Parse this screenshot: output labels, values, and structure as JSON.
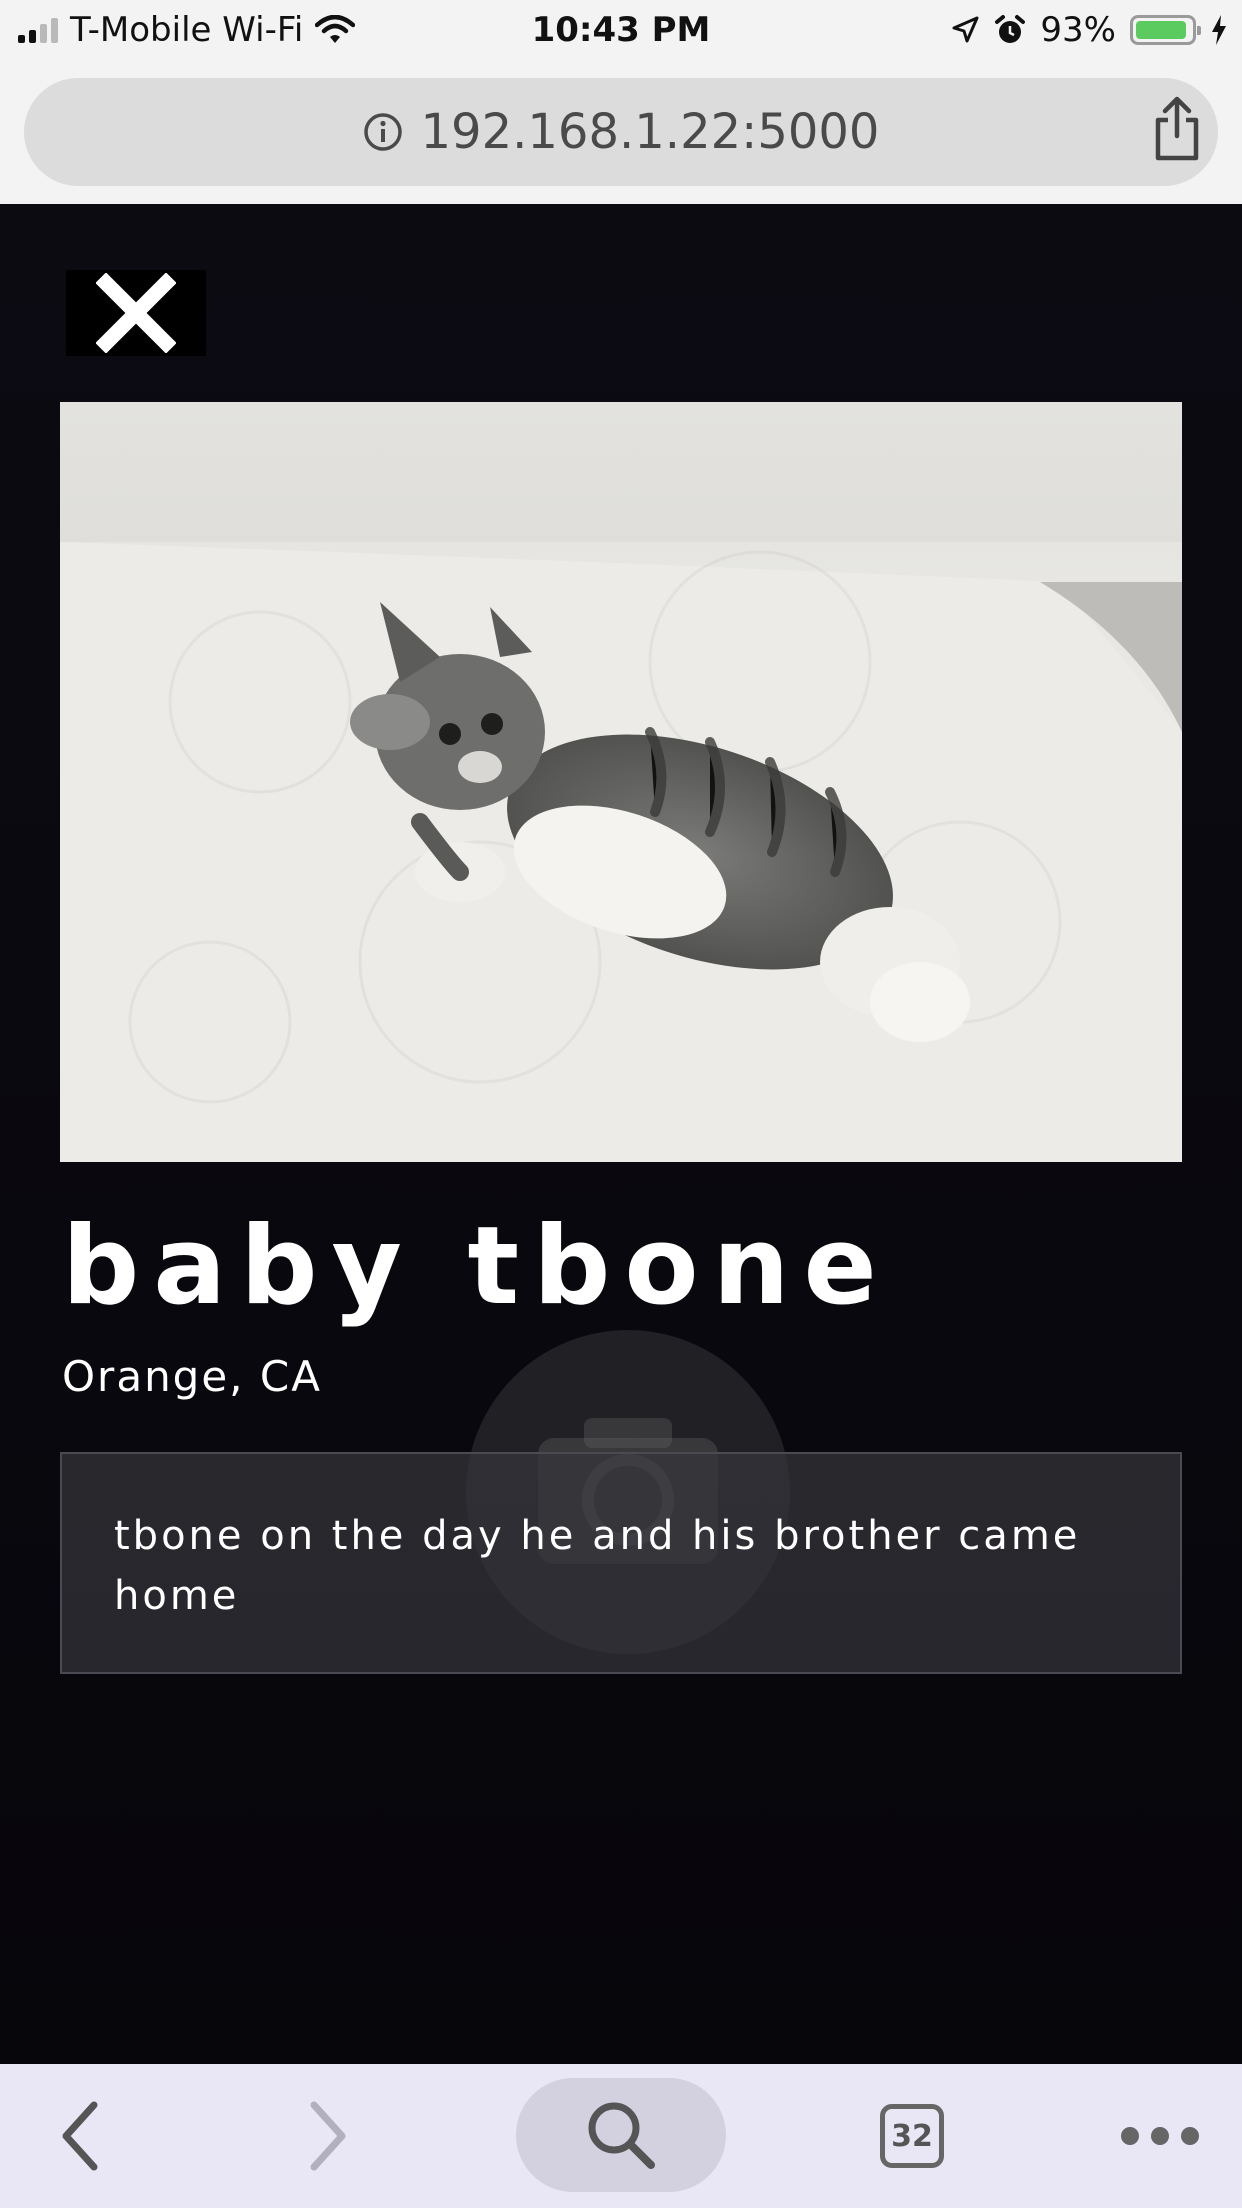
{
  "status_bar": {
    "carrier": "T-Mobile Wi-Fi",
    "time": "10:43 PM",
    "battery_percent": "93%",
    "battery_level": 0.93,
    "icons": [
      "cellular-signal-icon",
      "wifi-icon",
      "location-arrow-icon",
      "alarm-icon",
      "battery-icon",
      "charging-bolt-icon"
    ]
  },
  "browser": {
    "url": "192.168.1.22:5000",
    "info_icon": "info-circle-icon",
    "share_icon": "share-icon"
  },
  "detail": {
    "close_icon": "close-x-icon",
    "photo_description_icon": "kitten-photo",
    "title": "baby tbone",
    "location": "Orange, CA",
    "caption": "tbone on the day he and his brother came home",
    "camera_overlay_icon": "camera-icon"
  },
  "toolbar": {
    "tabs_count": "32",
    "icons": [
      "back-chevron-icon",
      "forward-chevron-icon",
      "search-icon",
      "tabs-icon",
      "more-dots-icon"
    ]
  },
  "colors": {
    "page_background": "#0b0a10",
    "browser_chrome": "#f3f3f3",
    "toolbar_background": "#e9e7f6",
    "battery_fill": "#5ccb5f"
  }
}
